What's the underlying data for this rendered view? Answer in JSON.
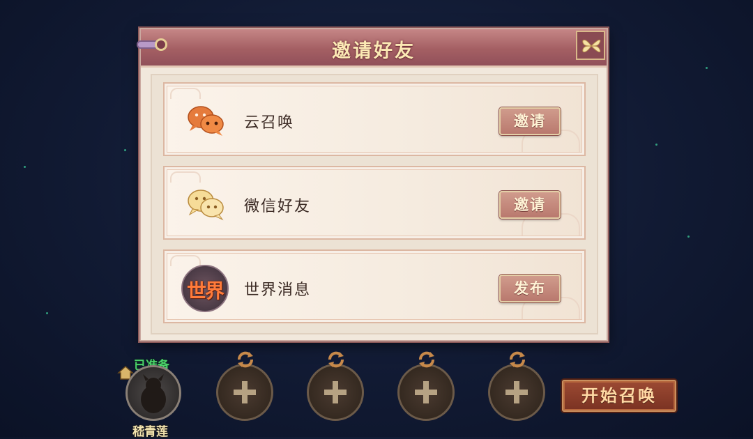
{
  "dialog": {
    "title": "邀请好友",
    "rows": [
      {
        "icon": "cloud-chat-icon",
        "label": "云召唤",
        "button": "邀请"
      },
      {
        "icon": "wechat-icon",
        "label": "微信好友",
        "button": "邀请"
      },
      {
        "icon": "world-badge-icon",
        "badge_text": "世界",
        "label": "世界消息",
        "button": "发布"
      }
    ]
  },
  "party": {
    "ready_status": "已准备",
    "player_name": "嵇青莲",
    "empty_slots": 4
  },
  "start_button": "开始召唤",
  "colors": {
    "title_bar": "#a45f63",
    "title_text": "#fbe9b4",
    "row_button": "#c58a7d",
    "ready_green": "#4bd36a",
    "start_button": "#8a3c28"
  }
}
